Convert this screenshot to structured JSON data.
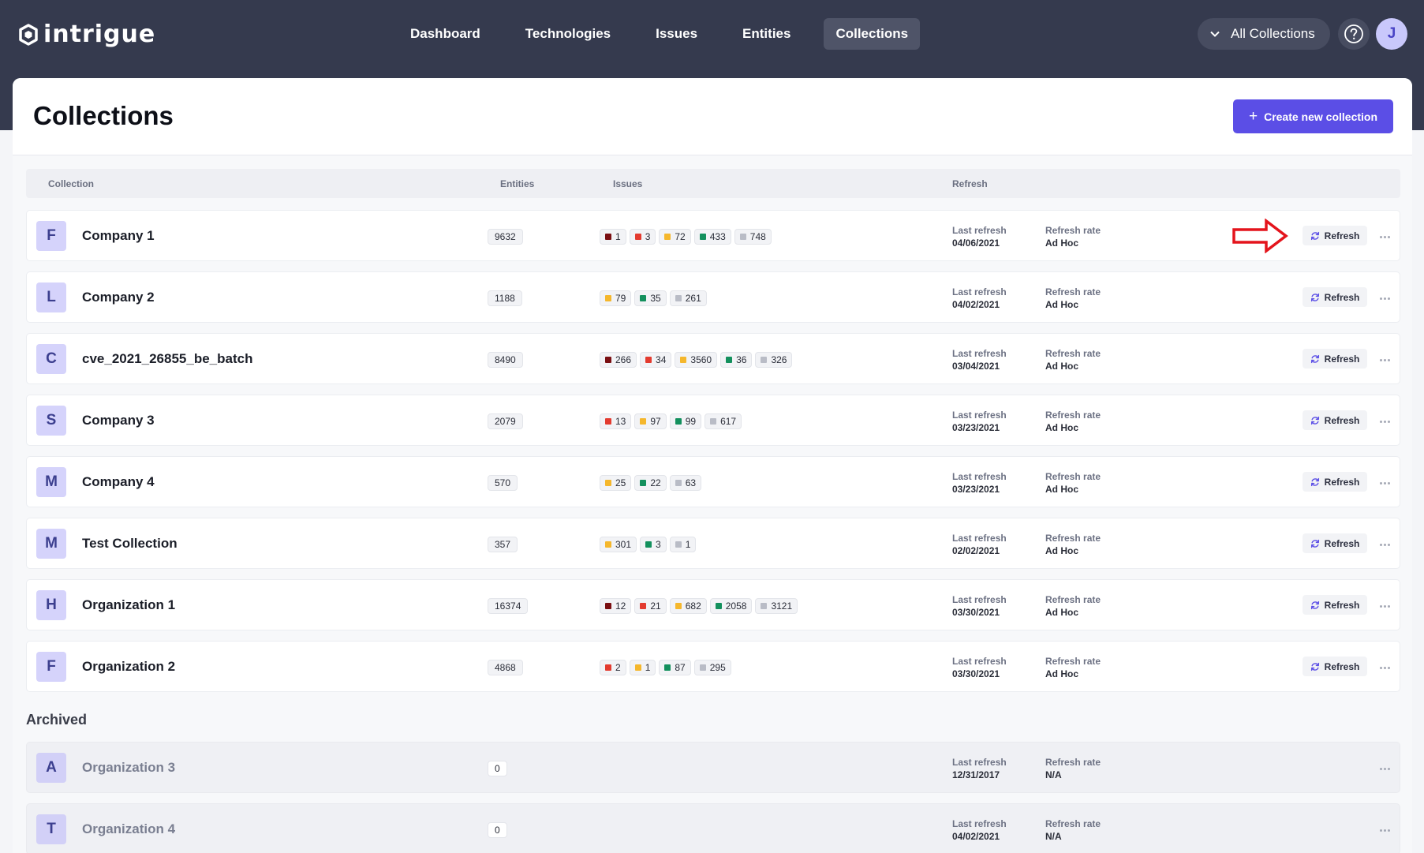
{
  "app": {
    "name": "intrigue"
  },
  "nav": {
    "tabs": [
      {
        "label": "Dashboard",
        "active": false
      },
      {
        "label": "Technologies",
        "active": false
      },
      {
        "label": "Issues",
        "active": false
      },
      {
        "label": "Entities",
        "active": false
      },
      {
        "label": "Collections",
        "active": true
      }
    ],
    "scope_select": "All Collections",
    "user_initial": "J"
  },
  "page": {
    "title": "Collections",
    "create_button": "Create new collection",
    "columns": {
      "collection": "Collection",
      "entities": "Entities",
      "issues": "Issues",
      "refresh": "Refresh"
    },
    "archived_label": "Archived"
  },
  "labels": {
    "last_refresh": "Last refresh",
    "refresh_rate": "Refresh rate",
    "refresh_button": "Refresh"
  },
  "colors": {
    "critical": "#7a0f12",
    "high": "#e33b2f",
    "medium": "#f5b72c",
    "low": "#13905d",
    "info": "#b9bcc6",
    "accent": "#5b4ee6",
    "annotation": "#e4141c"
  },
  "collections": [
    {
      "letter": "F",
      "name": "Company 1",
      "entities": "9632",
      "issues": [
        {
          "sev": "critical",
          "count": "1"
        },
        {
          "sev": "high",
          "count": "3"
        },
        {
          "sev": "medium",
          "count": "72"
        },
        {
          "sev": "low",
          "count": "433"
        },
        {
          "sev": "info",
          "count": "748"
        }
      ],
      "last_refresh": "04/06/2021",
      "refresh_rate": "Ad Hoc"
    },
    {
      "letter": "L",
      "name": "Company 2",
      "entities": "1188",
      "issues": [
        {
          "sev": "medium",
          "count": "79"
        },
        {
          "sev": "low",
          "count": "35"
        },
        {
          "sev": "info",
          "count": "261"
        }
      ],
      "last_refresh": "04/02/2021",
      "refresh_rate": "Ad Hoc"
    },
    {
      "letter": "C",
      "name": "cve_2021_26855_be_batch",
      "entities": "8490",
      "issues": [
        {
          "sev": "critical",
          "count": "266"
        },
        {
          "sev": "high",
          "count": "34"
        },
        {
          "sev": "medium",
          "count": "3560"
        },
        {
          "sev": "low",
          "count": "36"
        },
        {
          "sev": "info",
          "count": "326"
        }
      ],
      "last_refresh": "03/04/2021",
      "refresh_rate": "Ad Hoc"
    },
    {
      "letter": "S",
      "name": "Company 3",
      "entities": "2079",
      "issues": [
        {
          "sev": "high",
          "count": "13"
        },
        {
          "sev": "medium",
          "count": "97"
        },
        {
          "sev": "low",
          "count": "99"
        },
        {
          "sev": "info",
          "count": "617"
        }
      ],
      "last_refresh": "03/23/2021",
      "refresh_rate": "Ad Hoc"
    },
    {
      "letter": "M",
      "name": "Company 4",
      "entities": "570",
      "issues": [
        {
          "sev": "medium",
          "count": "25"
        },
        {
          "sev": "low",
          "count": "22"
        },
        {
          "sev": "info",
          "count": "63"
        }
      ],
      "last_refresh": "03/23/2021",
      "refresh_rate": "Ad Hoc"
    },
    {
      "letter": "M",
      "name": "Test Collection",
      "entities": "357",
      "issues": [
        {
          "sev": "medium",
          "count": "301"
        },
        {
          "sev": "low",
          "count": "3"
        },
        {
          "sev": "info",
          "count": "1"
        }
      ],
      "last_refresh": "02/02/2021",
      "refresh_rate": "Ad Hoc"
    },
    {
      "letter": "H",
      "name": "Organization 1",
      "entities": "16374",
      "issues": [
        {
          "sev": "critical",
          "count": "12"
        },
        {
          "sev": "high",
          "count": "21"
        },
        {
          "sev": "medium",
          "count": "682"
        },
        {
          "sev": "low",
          "count": "2058"
        },
        {
          "sev": "info",
          "count": "3121"
        }
      ],
      "last_refresh": "03/30/2021",
      "refresh_rate": "Ad Hoc"
    },
    {
      "letter": "F",
      "name": "Organization 2",
      "entities": "4868",
      "issues": [
        {
          "sev": "high",
          "count": "2"
        },
        {
          "sev": "medium",
          "count": "1"
        },
        {
          "sev": "low",
          "count": "87"
        },
        {
          "sev": "info",
          "count": "295"
        }
      ],
      "last_refresh": "03/30/2021",
      "refresh_rate": "Ad Hoc"
    }
  ],
  "archived": [
    {
      "letter": "A",
      "name": "Organization 3",
      "entities": "0",
      "issues": [],
      "last_refresh": "12/31/2017",
      "refresh_rate": "N/A"
    },
    {
      "letter": "T",
      "name": "Organization 4",
      "entities": "0",
      "issues": [],
      "last_refresh": "04/02/2021",
      "refresh_rate": "N/A"
    }
  ]
}
